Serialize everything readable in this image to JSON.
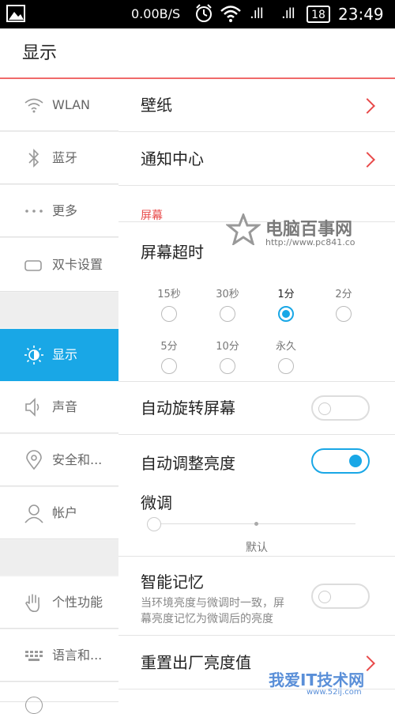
{
  "status_bar": {
    "network_speed": "0.00B/S",
    "signal1": ".ıll",
    "signal2": ".ıll",
    "battery": "18",
    "time": "23:49",
    "icons": [
      "image-icon",
      "alarm-icon",
      "wifi-icon",
      "signal-icon",
      "battery-icon"
    ]
  },
  "app_bar": {
    "title": "显示"
  },
  "sidebar": {
    "items": [
      {
        "label": "WLAN",
        "icon": "wifi-icon"
      },
      {
        "label": "蓝牙",
        "icon": "bluetooth-icon"
      },
      {
        "label": "更多",
        "icon": "more-icon"
      },
      {
        "label": "双卡设置",
        "icon": "sim-card-icon"
      },
      {
        "label": "显示",
        "icon": "brightness-icon",
        "active": true
      },
      {
        "label": "声音",
        "icon": "speaker-icon"
      },
      {
        "label": "安全和...",
        "icon": "location-icon"
      },
      {
        "label": "帐户",
        "icon": "account-icon"
      },
      {
        "label": "个性功能",
        "icon": "hand-icon"
      },
      {
        "label": "语言和...",
        "icon": "keyboard-icon"
      }
    ]
  },
  "main": {
    "wallpaper": "壁纸",
    "notification_center": "通知中心",
    "screen_section": "屏幕",
    "screen_timeout": "屏幕超时",
    "timeout_options": [
      "15秒",
      "30秒",
      "1分",
      "2分",
      "5分",
      "10分",
      "永久"
    ],
    "timeout_selected": "1分",
    "auto_rotate": {
      "label": "自动旋转屏幕",
      "on": false
    },
    "auto_brightness": {
      "label": "自动调整亮度",
      "on": true
    },
    "fine_tune": {
      "label": "微调",
      "default_label": "默认",
      "level": 0
    },
    "smart_memory": {
      "label": "智能记忆",
      "desc_line1": "当环境亮度与微调时一致，屏",
      "desc_line2": "幕亮度记忆为微调后的亮度",
      "on": false
    },
    "reset_brightness": "重置出厂亮度值"
  },
  "watermarks": {
    "top_title": "电脑百事网",
    "top_url": "http://www.pc841.co",
    "bottom_title": "我爱IT技术网",
    "bottom_url": "www.52ij.com"
  },
  "colors": {
    "accent": "#19a7e6",
    "red": "#e84a4a"
  }
}
